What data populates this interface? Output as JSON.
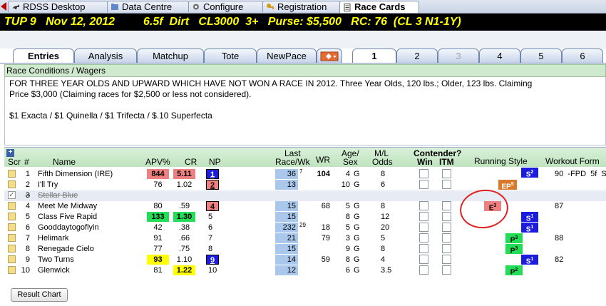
{
  "app_tabs": [
    {
      "label": "RDSS Desktop",
      "icon": "horse-icon"
    },
    {
      "label": "Data Centre",
      "icon": "folder-icon"
    },
    {
      "label": "Configure",
      "icon": "gear-icon"
    },
    {
      "label": "Registration",
      "icon": "key-icon"
    },
    {
      "label": "Race Cards",
      "icon": "document-icon",
      "active": true
    }
  ],
  "race_header": "TUP 9   Nov 12, 2012         6.5f  Dirt   CL3000  3+   Purse: $5,500   RC: 76  (CL 3 N1-1Y)",
  "sub_tabs": [
    "Entries",
    "Analysis",
    "Matchup",
    "Tote",
    "NewPace"
  ],
  "race_numbers": [
    "1",
    "2",
    "3",
    "4",
    "5",
    "6"
  ],
  "conditions": {
    "header": "Race Conditions / Wagers",
    "line1": "FOR THREE YEAR OLDS AND UPWARD WHICH HAVE NOT WON A RACE IN 2012. Three Year Olds, 120 lbs.; Older, 123 lbs. Claiming",
    "line2": "Price $3,000 (Claiming races for $2,500 or less not considered).",
    "wagers": "$1 Exacta / $1 Quinella / $1 Trifecta / $.10 Superfecta"
  },
  "columns": {
    "scr": "Scr",
    "num": "#",
    "name": "Name",
    "apv": "APV%",
    "cr": "CR",
    "np": "NP",
    "last_top": "Last",
    "last_bottom": "Race/Wk",
    "wr": "WR",
    "age_top": "Age/",
    "age_bottom": "Sex",
    "ml_top": "M/L",
    "ml_bottom": "Odds",
    "contender": "Contender?",
    "win": "Win",
    "itm": "ITM",
    "running_style": "Running Style",
    "workout": "Workout Form"
  },
  "colors": {
    "red": "#f08080",
    "green": "#22dd55",
    "yellow": "#ffff00",
    "blue": "#1c1ce0",
    "orange": "#d8792b",
    "last": "#a9c8ec"
  },
  "horses": [
    {
      "num": "1",
      "name": "Fifth Dimension (IRE)",
      "apv": "844",
      "apv_bg": "red",
      "cr": "5.11",
      "cr_bg": "red",
      "np": "1",
      "np_bg": "blue",
      "last": "36",
      "last_sup": "7",
      "wr": "104",
      "age": "4",
      "sex": "G",
      "ml": "8",
      "rs": "S",
      "rs_sup": "2",
      "rs_bg": "blue",
      "workout": "90  -FPD  5f  S"
    },
    {
      "num": "2",
      "name": "I'll Try",
      "apv": "76",
      "cr": "1.02",
      "np": "2",
      "np_bg": "red",
      "last": "13",
      "wr": "",
      "age": "10",
      "sex": "G",
      "ml": "6",
      "rs": "EP",
      "rs_sup": "5",
      "rs_bg": "orange",
      "workout": ""
    },
    {
      "num": "3",
      "name": "Stellar Blue",
      "scratched": true,
      "apv": "",
      "cr": "",
      "np": "",
      "last": "",
      "wr": "",
      "age": "",
      "sex": "",
      "ml": "",
      "rs": "",
      "workout": ""
    },
    {
      "num": "4",
      "name": "Meet Me Midway",
      "apv": "80",
      "cr": ".59",
      "np": "4",
      "np_bg": "red",
      "last": "15",
      "wr": "68",
      "age": "5",
      "sex": "G",
      "ml": "8",
      "rs": "E",
      "rs_sup": "3",
      "rs_bg": "red",
      "workout": "87"
    },
    {
      "num": "5",
      "name": "Class Five Rapid",
      "apv": "133",
      "apv_bg": "green",
      "cr": "1.30",
      "cr_bg": "green",
      "np": "5",
      "last": "15",
      "wr": "",
      "age": "8",
      "sex": "G",
      "ml": "12",
      "rs": "S",
      "rs_sup": "1",
      "rs_bg": "blue",
      "workout": ""
    },
    {
      "num": "6",
      "name": "Gooddaytogoflyin",
      "apv": "42",
      "cr": ".38",
      "np": "6",
      "last": "232",
      "last_sup": "29",
      "wr": "18",
      "age": "5",
      "sex": "G",
      "ml": "20",
      "rs": "S",
      "rs_sup": "1",
      "rs_bg": "blue",
      "workout": ""
    },
    {
      "num": "7",
      "name": "Helimark",
      "apv": "91",
      "cr": ".66",
      "np": "7",
      "last": "21",
      "wr": "79",
      "age": "3",
      "sex": "G",
      "ml": "5",
      "rs": "P",
      "rs_sup": "3",
      "rs_bg": "green",
      "workout": "88"
    },
    {
      "num": "8",
      "name": "Renegade Cielo",
      "apv": "77",
      "cr": ".75",
      "np": "8",
      "last": "15",
      "wr": "",
      "age": "9",
      "sex": "G",
      "ml": "8",
      "rs": "P",
      "rs_sup": "3",
      "rs_bg": "green",
      "workout": ""
    },
    {
      "num": "9",
      "name": "Two Turns",
      "apv": "93",
      "apv_bg": "yellow",
      "cr": "1.10",
      "np": "9",
      "np_bg": "blue",
      "last": "14",
      "wr": "59",
      "age": "8",
      "sex": "G",
      "ml": "4",
      "rs": "S",
      "rs_sup": "1",
      "rs_bg": "blue",
      "workout": "82"
    },
    {
      "num": "10",
      "name": "Glenwick",
      "apv": "81",
      "cr": "1.22",
      "cr_bg": "yellow",
      "np": "10",
      "last": "12",
      "wr": "",
      "age": "6",
      "sex": "G",
      "ml": "3.5",
      "rs": "P",
      "rs_sup": "2",
      "rs_bg": "green",
      "workout": ""
    }
  ],
  "result_button": "Result Chart"
}
